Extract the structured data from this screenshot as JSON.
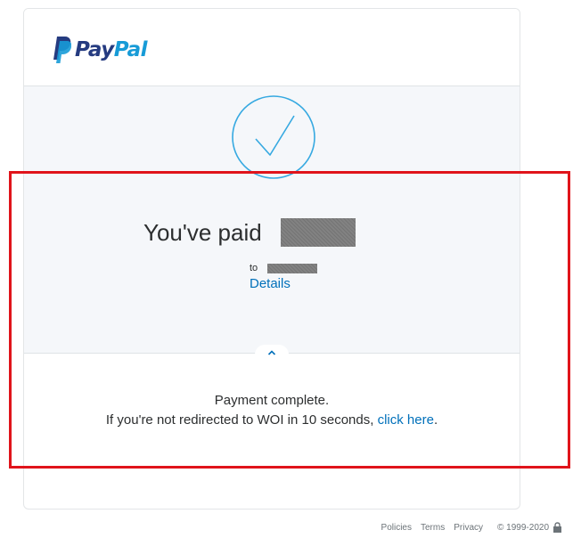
{
  "brand": {
    "pay": "Pay",
    "pal": "Pal"
  },
  "confirmation": {
    "paid_label": "You've paid",
    "to_label": "to",
    "details_link": "Details"
  },
  "status": {
    "message": "Payment complete.",
    "redirect_prefix": "If you're not redirected to WOI in 10 seconds, ",
    "click_link": "click here",
    "redirect_suffix": "."
  },
  "footer": {
    "policies": "Policies",
    "terms": "Terms",
    "privacy": "Privacy",
    "copyright": "© 1999-2020"
  },
  "icons": {
    "logo": "paypal-logo-icon",
    "check": "checkmark-circle-icon",
    "toggle": "chevron-up-icon",
    "lock": "lock-icon"
  },
  "colors": {
    "brand_dark": "#253b80",
    "brand_light": "#179bd7",
    "link": "#0070ba",
    "check": "#36a9e1",
    "highlight": "#e0141b"
  }
}
